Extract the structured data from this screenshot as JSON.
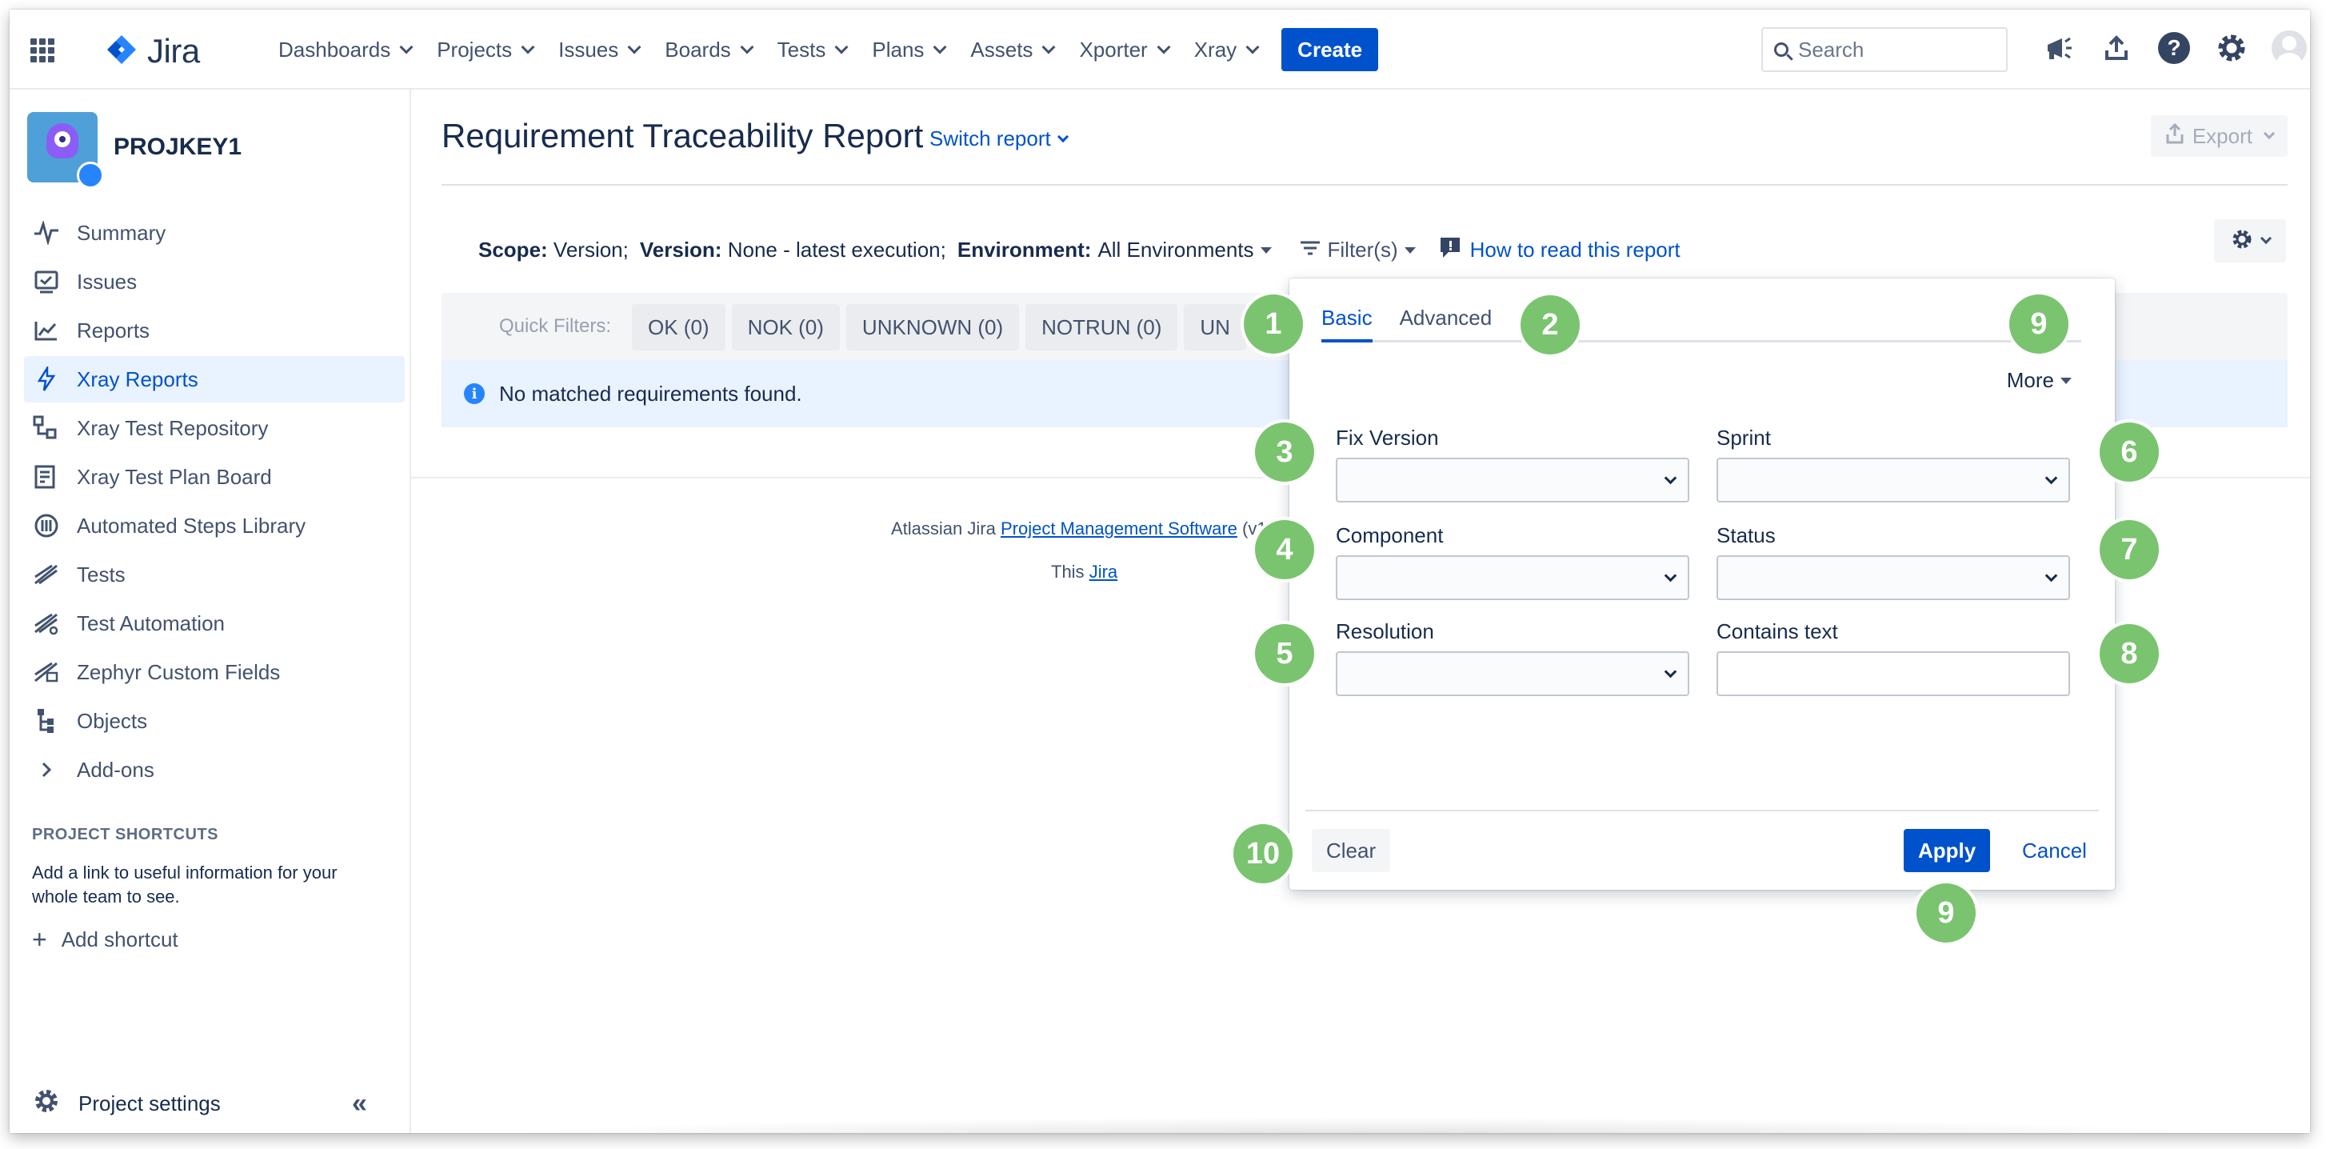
{
  "topnav": {
    "brand": "Jira",
    "menu": [
      {
        "label": "Dashboards"
      },
      {
        "label": "Projects"
      },
      {
        "label": "Issues"
      },
      {
        "label": "Boards"
      },
      {
        "label": "Tests"
      },
      {
        "label": "Plans"
      },
      {
        "label": "Assets"
      },
      {
        "label": "Xporter"
      },
      {
        "label": "Xray"
      }
    ],
    "create_label": "Create",
    "search_placeholder": "Search",
    "icons": [
      "notifications-icon",
      "upload-icon",
      "help-icon",
      "settings-icon",
      "avatar"
    ]
  },
  "sidebar": {
    "project_name": "PROJKEY1",
    "items": [
      {
        "label": "Summary",
        "icon": "summary-icon"
      },
      {
        "label": "Issues",
        "icon": "issues-icon"
      },
      {
        "label": "Reports",
        "icon": "reports-icon"
      },
      {
        "label": "Xray Reports",
        "icon": "xray-reports-icon",
        "active": true
      },
      {
        "label": "Xray Test Repository",
        "icon": "test-repository-icon"
      },
      {
        "label": "Xray Test Plan Board",
        "icon": "test-plan-board-icon"
      },
      {
        "label": "Automated Steps Library",
        "icon": "steps-library-icon"
      },
      {
        "label": "Tests",
        "icon": "tests-icon"
      },
      {
        "label": "Test Automation",
        "icon": "test-automation-icon"
      },
      {
        "label": "Zephyr Custom Fields",
        "icon": "zephyr-icon"
      },
      {
        "label": "Objects",
        "icon": "objects-icon"
      },
      {
        "label": "Add-ons",
        "icon": "chevron-right-icon"
      }
    ],
    "shortcuts_heading": "PROJECT SHORTCUTS",
    "shortcuts_text": "Add a link to useful information for your whole team to see.",
    "add_shortcut": "Add shortcut",
    "project_settings": "Project settings"
  },
  "main": {
    "title": "Requirement Traceability Report",
    "switch_report": "Switch report",
    "export": "Export",
    "scope": {
      "scope_label": "Scope:",
      "scope_value": "Version;",
      "version_label": "Version:",
      "version_value": "None - latest execution;",
      "env_label": "Environment:",
      "env_value": "All Environments",
      "filters": "Filter(s)",
      "howto": "How to read this report"
    },
    "quick_filters_label": "Quick Filters:",
    "quick_filters": [
      "OK (0)",
      "NOK (0)",
      "UNKNOWN (0)",
      "NOTRUN (0)",
      "UN"
    ],
    "info_message": "No matched requirements found.",
    "footer_line1_prefix": "Atlassian Jira",
    "footer_line1_link": "Project Management Software",
    "footer_line1_suffix": "(v1",
    "footer_line2_prefix": "This",
    "footer_line2_link": "Jira"
  },
  "popup": {
    "tabs": [
      {
        "label": "Basic",
        "active": true
      },
      {
        "label": "Advanced"
      }
    ],
    "more": "More",
    "fields": {
      "fix_version": "Fix Version",
      "sprint": "Sprint",
      "component": "Component",
      "status": "Status",
      "resolution": "Resolution",
      "contains_text": "Contains text"
    },
    "clear": "Clear",
    "apply": "Apply",
    "cancel": "Cancel"
  },
  "callouts": [
    "1",
    "2",
    "9",
    "3",
    "6",
    "4",
    "7",
    "5",
    "8",
    "10",
    "9"
  ],
  "colors": {
    "accent": "#0052CC",
    "callout": "#7AC46F",
    "active_bg": "#E9F2FF"
  }
}
